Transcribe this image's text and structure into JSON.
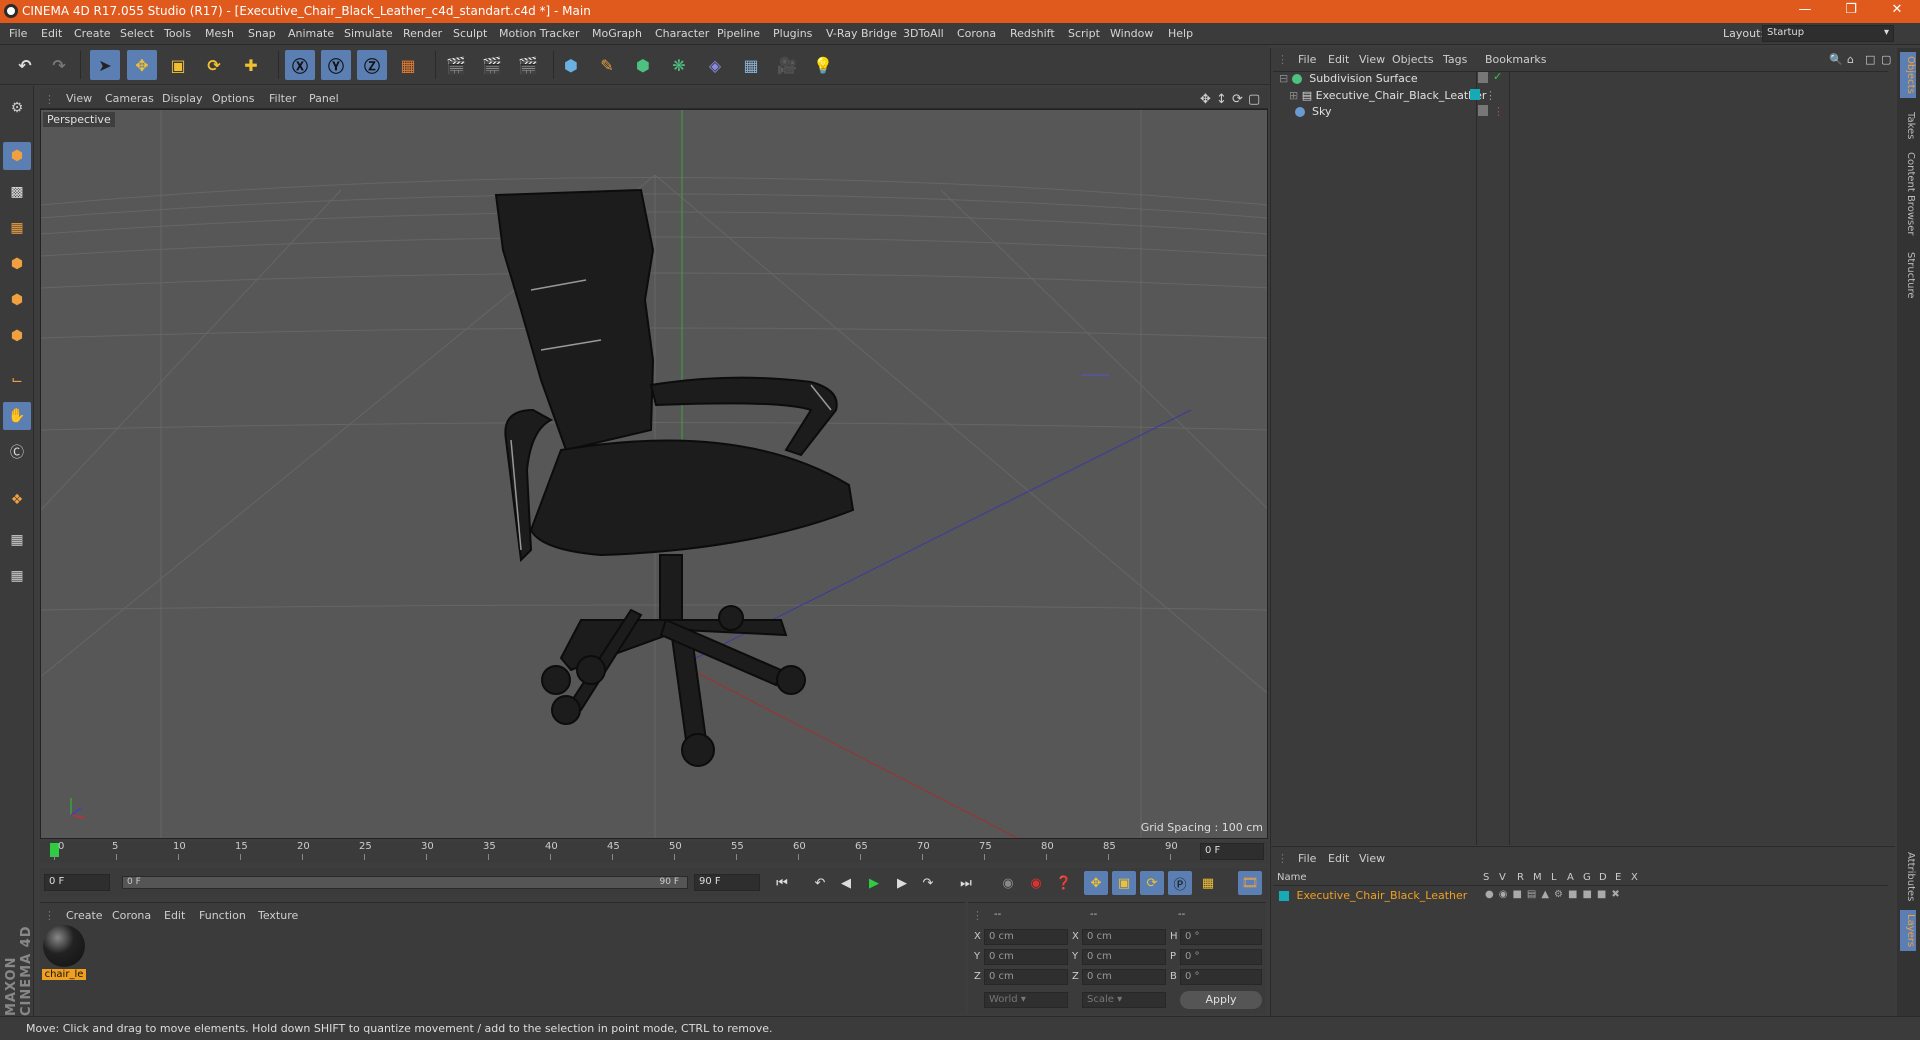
{
  "window": {
    "title": "CINEMA 4D R17.055 Studio (R17) - [Executive_Chair_Black_Leather_c4d_standart.c4d *] - Main",
    "layout_label": "Layout:",
    "layout_value": "Startup"
  },
  "menu": [
    "File",
    "Edit",
    "Create",
    "Select",
    "Tools",
    "Mesh",
    "Snap",
    "Animate",
    "Simulate",
    "Render",
    "Sculpt",
    "Motion Tracker",
    "MoGraph",
    "Character",
    "Pipeline",
    "Plugins",
    "V-Ray Bridge",
    "3DToAll",
    "Corona",
    "Redshift",
    "Script",
    "Window",
    "Help"
  ],
  "viewport": {
    "menu": [
      "View",
      "Cameras",
      "Display",
      "Options",
      "Filter",
      "Panel"
    ],
    "label": "Perspective",
    "grid_spacing": "Grid Spacing : 100 cm"
  },
  "timeline": {
    "ticks": [
      "0",
      "5",
      "10",
      "15",
      "20",
      "25",
      "30",
      "35",
      "40",
      "45",
      "50",
      "55",
      "60",
      "65",
      "70",
      "75",
      "80",
      "85",
      "90"
    ],
    "end_frame": "0 F"
  },
  "transport": {
    "start": "0 F",
    "range_start": "0 F",
    "range_end": "90 F",
    "end": "90 F"
  },
  "materials": {
    "menu": [
      "Create",
      "Corona",
      "Edit",
      "Function",
      "Texture"
    ],
    "items": [
      {
        "name": "chair_le"
      }
    ]
  },
  "coords": {
    "headers": [
      "--",
      "--",
      "--"
    ],
    "rows": [
      {
        "a": "X",
        "v1": "0 cm",
        "b": "X",
        "v2": "0 cm",
        "c": "H",
        "v3": "0 °"
      },
      {
        "a": "Y",
        "v1": "0 cm",
        "b": "Y",
        "v2": "0 cm",
        "c": "P",
        "v3": "0 °"
      },
      {
        "a": "Z",
        "v1": "0 cm",
        "b": "Z",
        "v2": "0 cm",
        "c": "B",
        "v3": "0 °"
      }
    ],
    "mode1": "World",
    "mode2": "Scale",
    "apply": "Apply"
  },
  "objects": {
    "menu": [
      "File",
      "Edit",
      "View",
      "Objects",
      "Tags",
      "Bookmarks"
    ],
    "items": [
      {
        "name": "Subdivision Surface"
      },
      {
        "name": "Executive_Chair_Black_Leather"
      },
      {
        "name": "Sky"
      }
    ]
  },
  "layers": {
    "menu": [
      "File",
      "Edit",
      "View"
    ],
    "cols": [
      "Name",
      "S",
      "V",
      "R",
      "M",
      "L",
      "A",
      "G",
      "D",
      "E",
      "X"
    ],
    "items": [
      {
        "name": "Executive_Chair_Black_Leather"
      }
    ]
  },
  "side_tabs": [
    "Objects",
    "Takes",
    "Content Browser",
    "Structure"
  ],
  "side_tabs_bottom": [
    "Attributes",
    "Layers"
  ],
  "status": "Move: Click and drag to move elements. Hold down SHIFT to quantize movement / add to the selection in point mode, CTRL to remove.",
  "brand": "MAXON CINEMA 4D",
  "colors": {
    "titlebar": "#e05a1e",
    "accent": "#5b7fb3",
    "layer": "#f0a020"
  }
}
